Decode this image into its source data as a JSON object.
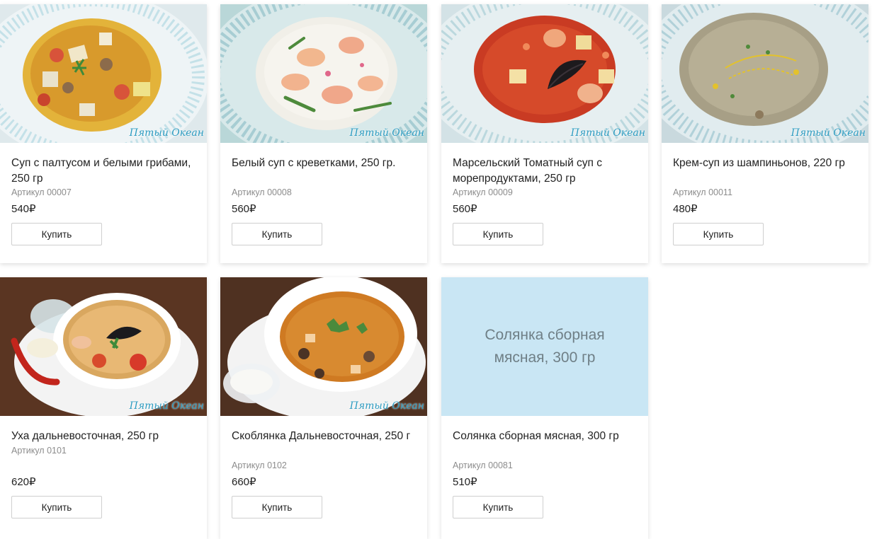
{
  "logo_text": "Пятый Океан",
  "buy_label": "Купить",
  "products": [
    {
      "title": "Суп с палтусом и белыми грибами, 250 гр",
      "sku": "Артикул 00007",
      "price": "540₽",
      "image": "halibut-mushroom-soup"
    },
    {
      "title": "Белый суп с креветками, 250 гр.",
      "sku": "Артикул 00008",
      "price": "560₽",
      "image": "white-shrimp-soup"
    },
    {
      "title": "Марсельский Томатный суп с морепродуктами, 250 гр",
      "sku": "Артикул 00009",
      "price": "560₽",
      "image": "tomato-seafood-soup"
    },
    {
      "title": "Крем-суп из шампиньонов, 220 гр",
      "sku": "Артикул 00011",
      "price": "480₽",
      "image": "mushroom-cream-soup"
    },
    {
      "title": "Уха дальневосточная, 250 гр",
      "sku": "Артикул 0101",
      "price": "620₽",
      "image": "far-east-fish-soup"
    },
    {
      "title": "Скоблянка Дальневосточная, 250 г",
      "sku": "Артикул 0102",
      "price": "660₽",
      "image": "skoblyanka"
    },
    {
      "title": "Солянка сборная мясная, 300 гр",
      "sku": "Артикул 00081",
      "price": "510₽",
      "image": "placeholder",
      "placeholder_text": "Солянка сборная мясная, 300 гр"
    }
  ]
}
